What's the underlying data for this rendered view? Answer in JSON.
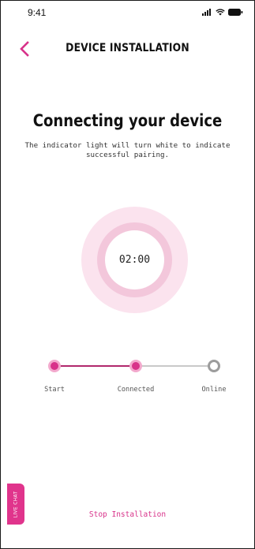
{
  "status_bar": {
    "time": "9:41",
    "icons": [
      "signal-icon",
      "wifi-icon",
      "battery-icon"
    ]
  },
  "header": {
    "back_icon": "chevron-left-icon",
    "title": "DEVICE INSTALLATION"
  },
  "main": {
    "title": "Connecting your device",
    "subtitle": "The indicator light will turn white to indicate successful pairing."
  },
  "timer": {
    "value": "02:00"
  },
  "stepper": {
    "steps": [
      {
        "label": "Start",
        "state": "done"
      },
      {
        "label": "Connected",
        "state": "done"
      },
      {
        "label": "Online",
        "state": "todo"
      }
    ]
  },
  "live_chat": {
    "label": "LIVE CHAT"
  },
  "footer": {
    "stop_label": "Stop Installation"
  },
  "colors": {
    "accent": "#d8328a",
    "accent_dark": "#b1286c",
    "timer_outer": "#fbe3ee",
    "timer_ring": "#f3c7db",
    "inactive": "#9c9c9c"
  }
}
